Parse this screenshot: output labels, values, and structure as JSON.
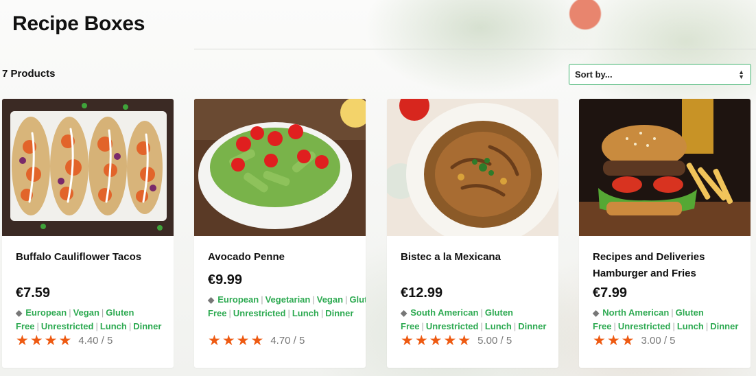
{
  "page": {
    "title": "Recipe Boxes",
    "product_count": "7 Products",
    "sort": {
      "label": "Sort by..."
    }
  },
  "colors": {
    "accent_green": "#2eaa52",
    "star_orange": "#ee5a12",
    "sort_border": "#3bb06a"
  },
  "products": [
    {
      "name": "Buffalo Cauliflower Tacos",
      "price": "€7.59",
      "tags": [
        "European",
        "Vegan",
        "Gluten Free",
        "Unrestricted",
        "Lunch",
        "Dinner"
      ],
      "rating_value": 4.4,
      "rating_text": "4.40 / 5",
      "image_icon": "tacos-image"
    },
    {
      "name": "Avocado Penne",
      "price": "€9.99",
      "tags": [
        "European",
        "Vegetarian",
        "Vegan",
        "Gluten Free",
        "Unrestricted",
        "Lunch",
        "Dinner"
      ],
      "rating_value": 4.7,
      "rating_text": "4.70 / 5",
      "image_icon": "pasta-image"
    },
    {
      "name": "Bistec a la Mexicana",
      "price": "€12.99",
      "tags": [
        "South American",
        "Gluten Free",
        "Unrestricted",
        "Lunch",
        "Dinner"
      ],
      "rating_value": 5.0,
      "rating_text": "5.00 / 5",
      "image_icon": "stew-image"
    },
    {
      "name": "Recipes and Deliveries Hamburger and Fries",
      "price": "€7.99",
      "tags": [
        "North American",
        "Gluten Free",
        "Unrestricted",
        "Lunch",
        "Dinner"
      ],
      "rating_value": 3.0,
      "rating_text": "3.00 / 5",
      "image_icon": "burger-image"
    }
  ]
}
